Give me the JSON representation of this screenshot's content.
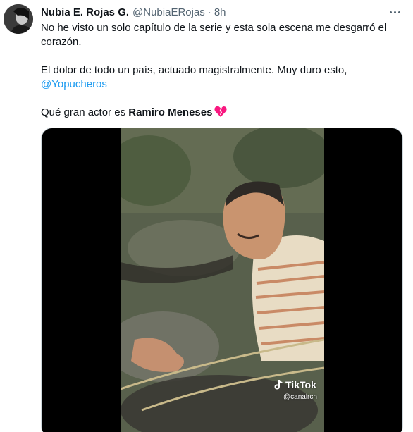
{
  "tweet": {
    "author": {
      "display_name": "Nubia E. Rojas G.",
      "handle": "@NubiaERojas",
      "separator": "·",
      "time": "8h"
    },
    "more_icon": "more-horizontal-icon",
    "text": {
      "line1": "No he visto un solo capítulo de la serie y esta sola escena me desgarró el corazón.",
      "line2": "El dolor de todo un país, actuado magistralmente. Muy duro esto,",
      "mention": "@Yopucheros",
      "line3_prefix": "Qué gran actor es ",
      "line3_bold": "Ramiro Meneses",
      "emoji": "broken-heart-icon"
    },
    "media": {
      "type": "video",
      "watermark_brand": "TikTok",
      "watermark_handle": "@canalrcn"
    }
  },
  "colors": {
    "link": "#1d9bf0",
    "secondary_text": "#536471",
    "primary_text": "#0f1419",
    "broken_heart": "#f91880"
  }
}
